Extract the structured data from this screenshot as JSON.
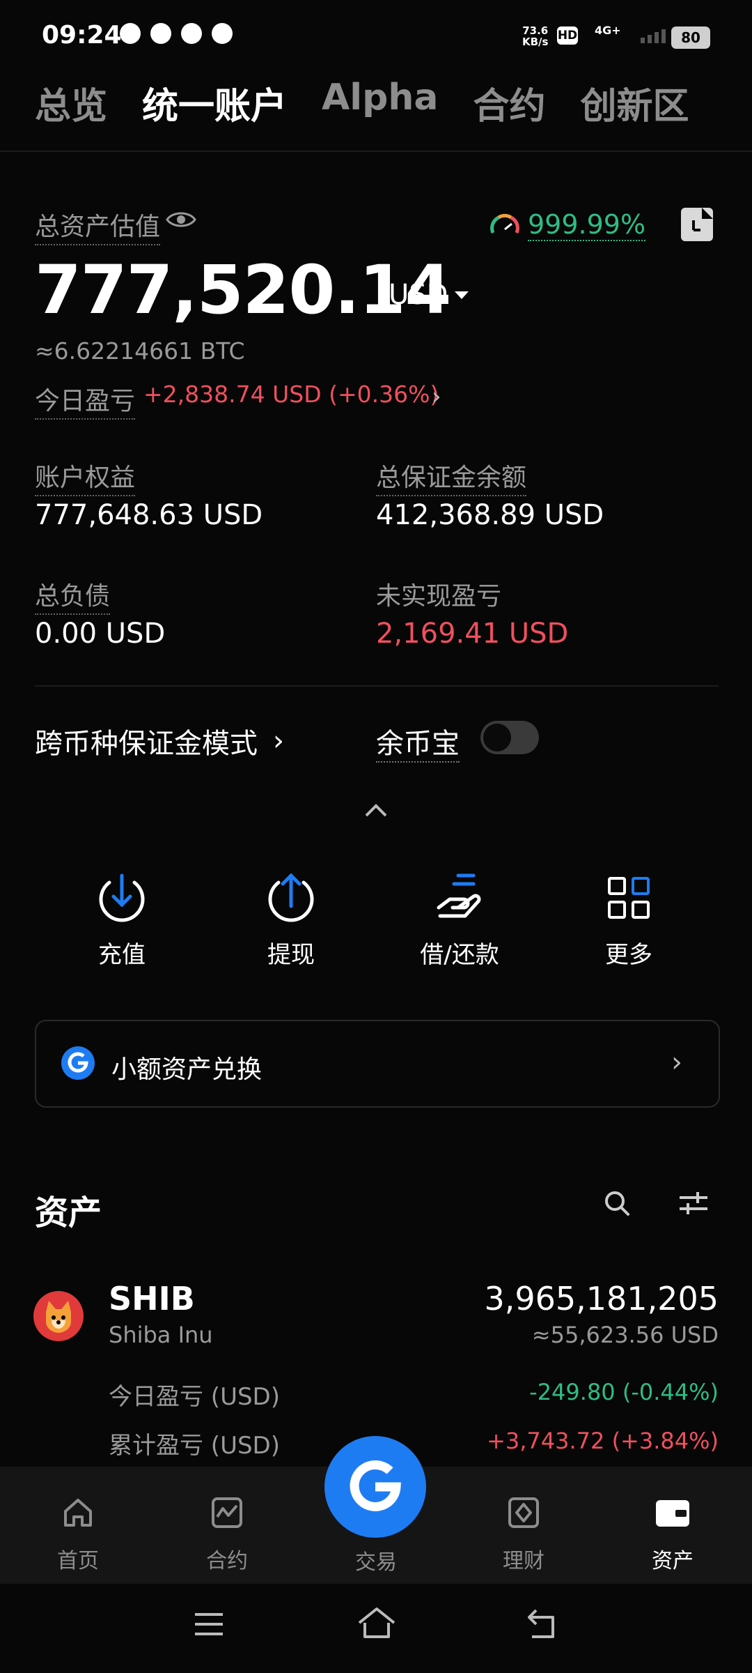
{
  "status_bar": {
    "time": "09:24",
    "net_speed_value": "73.6",
    "net_speed_unit": "KB/s",
    "hd": "HD",
    "network": "4G+",
    "battery": "80"
  },
  "tabs": [
    {
      "label": "总览",
      "active": false
    },
    {
      "label": "统一账户",
      "active": true
    },
    {
      "label": "Alpha",
      "active": false
    },
    {
      "label": "合约",
      "active": false
    },
    {
      "label": "创新区",
      "active": false
    }
  ],
  "summary": {
    "total_label": "总资产估值",
    "ratio": "999.99%",
    "total_value": "777,520.14",
    "currency": "USD",
    "btc_approx": "≈6.62214661 BTC",
    "today_pnl_label": "今日盈亏",
    "today_pnl_value": "+2,838.74 USD (+0.36%)"
  },
  "metrics": {
    "equity_label": "账户权益",
    "equity_value": "777,648.63 USD",
    "margin_label": "总保证金余额",
    "margin_value": "412,368.89 USD",
    "liability_label": "总负债",
    "liability_value": "0.00 USD",
    "unrealized_label": "未实现盈亏",
    "unrealized_value": "2,169.41 USD"
  },
  "mode": {
    "margin_mode_label": "跨币种保证金模式",
    "yubibao_label": "余币宝",
    "yubibao_on": false
  },
  "actions": [
    {
      "label": "充值",
      "icon": "deposit-icon"
    },
    {
      "label": "提现",
      "icon": "withdraw-icon"
    },
    {
      "label": "借/还款",
      "icon": "borrow-repay-icon"
    },
    {
      "label": "更多",
      "icon": "more-grid-icon"
    }
  ],
  "convert": {
    "label": "小额资产兑换"
  },
  "assets": {
    "title": "资产",
    "items": [
      {
        "symbol": "SHIB",
        "name": "Shiba Inu",
        "amount": "3,965,181,205",
        "usd_value": "≈55,623.56 USD",
        "today_pnl_label": "今日盈亏 (USD)",
        "today_pnl_value": "-249.80 (-0.44%)",
        "total_pnl_label": "累计盈亏 (USD)",
        "total_pnl_value": "+3,743.72 (+3.84%)"
      }
    ]
  },
  "bottom_nav": [
    {
      "label": "首页",
      "active": false
    },
    {
      "label": "合约",
      "active": false
    },
    {
      "label": "交易",
      "active": false
    },
    {
      "label": "理财",
      "active": false
    },
    {
      "label": "资产",
      "active": true
    }
  ],
  "colors": {
    "accent_blue": "#1e7cf3",
    "positive_green": "#2ebd85",
    "negative_red": "#f0505e",
    "background": "#070707"
  }
}
